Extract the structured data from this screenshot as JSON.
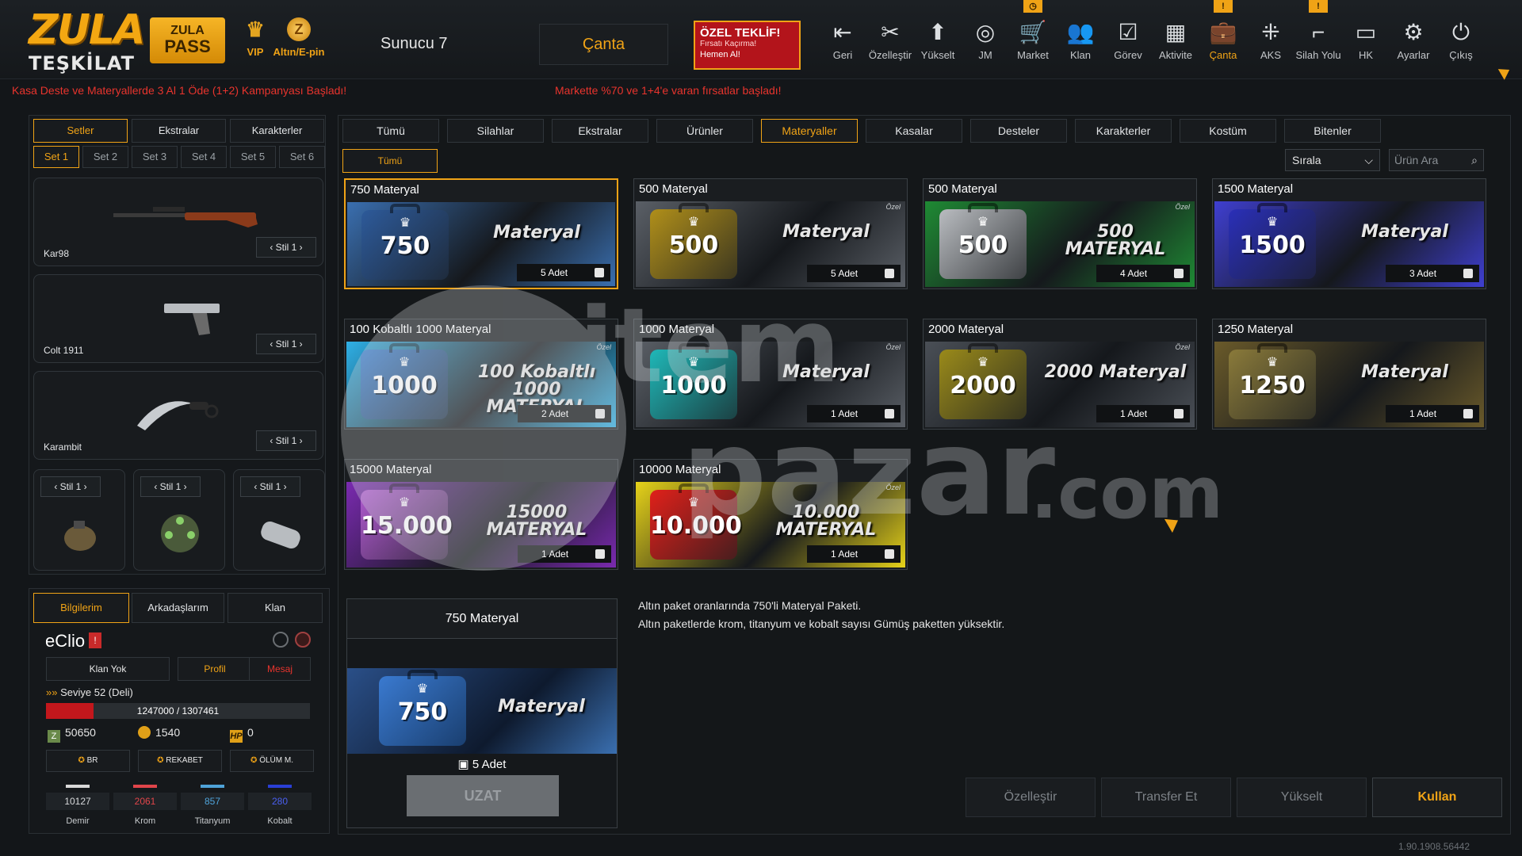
{
  "header": {
    "logo_line1": "ZULA",
    "logo_line2": "TEŞKİLAT",
    "pass_line1": "ZULA",
    "pass_line2": "PASS",
    "vip_label": "VIP",
    "altin_label": "Altın/E-pin",
    "server": "Sunucu 7",
    "canta_label": "Çanta",
    "offer": {
      "title": "ÖZEL TEKLİF!",
      "subtitle": "Fırsatı Kaçırma!",
      "cta": "Hemen Al!"
    },
    "nav": [
      {
        "label": "Geri",
        "icon": "back-icon"
      },
      {
        "label": "Özelleştir",
        "icon": "tools-icon"
      },
      {
        "label": "Yükselt",
        "icon": "upgrade-icon"
      },
      {
        "label": "JM",
        "icon": "coins-icon"
      },
      {
        "label": "Market",
        "icon": "cart-icon"
      },
      {
        "label": "Klan",
        "icon": "clan-icon"
      },
      {
        "label": "Görev",
        "icon": "clipboard-icon"
      },
      {
        "label": "Aktivite",
        "icon": "calendar-check-icon"
      },
      {
        "label": "Çanta",
        "icon": "bag-icon"
      },
      {
        "label": "AKS",
        "icon": "crosshair-icon"
      },
      {
        "label": "Silah Yolu",
        "icon": "gun-icon"
      },
      {
        "label": "HK",
        "icon": "wallet-icon"
      },
      {
        "label": "Ayarlar",
        "icon": "gear-icon"
      },
      {
        "label": "Çıkış",
        "icon": "power-icon"
      }
    ],
    "nav_badges": {
      "market": "◷",
      "canta": "!",
      "silah_yolu": "!"
    }
  },
  "tickers": {
    "left": "Kasa Deste ve Materyallerde 3 Al 1 Öde (1+2) Kampanyası Başladı!",
    "right": "Markette %70 ve 1+4'e varan fırsatlar başladı!"
  },
  "left_panel": {
    "tabs": [
      "Setler",
      "Ekstralar",
      "Karakterler"
    ],
    "set_tabs": [
      "Set 1",
      "Set 2",
      "Set 3",
      "Set 4",
      "Set 5",
      "Set 6"
    ],
    "weapons": [
      {
        "name": "Kar98",
        "style": "Stil 1"
      },
      {
        "name": "Colt 1911",
        "style": "Stil 1"
      },
      {
        "name": "Karambit",
        "style": "Stil 1"
      }
    ],
    "grenades": [
      {
        "style": "Stil 1",
        "icon": "grenade-icon"
      },
      {
        "style": "Stil 1",
        "icon": "mine-icon"
      },
      {
        "style": "Stil 1",
        "icon": "flashbang-icon"
      }
    ]
  },
  "profile": {
    "tabs": [
      "Bilgilerim",
      "Arkadaşlarım",
      "Klan"
    ],
    "name": "eClio",
    "badge": "!",
    "buttons": [
      "Klan Yok",
      "Profil",
      "Mesaj"
    ],
    "level": "Seviye 52 (Deli)",
    "xp_text": "1247000 / 1307461",
    "xp_fraction": 0.18,
    "zp": "50650",
    "gold": "1540",
    "hp": "0",
    "hp_label": "HP",
    "z_label": "Z",
    "mode_buttons": [
      "BR",
      "REKABET",
      "ÖLÜM M."
    ],
    "materials": [
      {
        "value": "10127",
        "label": "Demir",
        "color": "#d9d9d9"
      },
      {
        "value": "2061",
        "label": "Krom",
        "color": "#e0454a"
      },
      {
        "value": "857",
        "label": "Titanyum",
        "color": "#4fa3d9"
      },
      {
        "value": "280",
        "label": "Kobalt",
        "color": "#2a3fd6"
      }
    ]
  },
  "categories": [
    "Tümü",
    "Silahlar",
    "Ekstralar",
    "Ürünler",
    "Materyaller",
    "Kasalar",
    "Desteler",
    "Karakterler",
    "Kostüm",
    "Bitenler"
  ],
  "active_category": "Materyaller",
  "sub_tab": "Tümü",
  "sort_label": "Sırala",
  "search_placeholder": "Ürün Ara",
  "items": [
    {
      "title": "750 Materyal",
      "num": "750",
      "caption": "Materyal",
      "adet": "5 Adet",
      "color": "#2d5a9a",
      "bg": "#3a6fb0",
      "ozel": ""
    },
    {
      "title": "500 Materyal",
      "num": "500",
      "caption": "Materyal",
      "adet": "5 Adet",
      "color": "#b08f1a",
      "bg": "#5a5f66",
      "ozel": "Özel"
    },
    {
      "title": "500 Materyal",
      "num": "500",
      "caption": "500 MATERYAL",
      "adet": "4 Adet",
      "color": "#b9bcc0",
      "bg": "#1f8a34",
      "ozel": "Özel"
    },
    {
      "title": "1500 Materyal",
      "num": "1500",
      "caption": "Materyal",
      "adet": "3 Adet",
      "color": "#2a2fb8",
      "bg": "#3f3fd0",
      "ozel": ""
    },
    {
      "title": "100 Kobaltlı 1000 Materyal",
      "num": "1000",
      "caption": "100 Kobaltlı 1000 MATERYAL",
      "adet": "2 Adet",
      "color": "#3a7fd0",
      "bg": "#2fb0e6",
      "ozel": "Özel"
    },
    {
      "title": "1000 Materyal",
      "num": "1000",
      "caption": "Materyal",
      "adet": "1 Adet",
      "color": "#1fb8b8",
      "bg": "#5a5f66",
      "ozel": "Özel"
    },
    {
      "title": "2000 Materyal",
      "num": "2000",
      "caption": "2000 Materyal",
      "adet": "1 Adet",
      "color": "#9a8a1a",
      "bg": "#4a4f56",
      "ozel": "Özel"
    },
    {
      "title": "1250 Materyal",
      "num": "1250",
      "caption": "Materyal",
      "adet": "1 Adet",
      "color": "#8a7a3a",
      "bg": "#6a5a2a",
      "ozel": ""
    },
    {
      "title": "15000 Materyal",
      "num": "15.000",
      "caption": "15000 MATERYAL",
      "adet": "1 Adet",
      "color": "#b05ad0",
      "bg": "#7a2ab0",
      "ozel": ""
    },
    {
      "title": "10000 Materyal",
      "num": "10.000",
      "caption": "10.000 MATERYAL",
      "adet": "1 Adet",
      "color": "#e0201a",
      "bg": "#e6d21a",
      "ozel": "Özel"
    }
  ],
  "detail": {
    "title": "750 Materyal",
    "num": "750",
    "caption": "Materyal",
    "adet": "5 Adet",
    "uzat": "UZAT",
    "description_1": "Altın paket oranlarında 750'li Materyal Paketi.",
    "description_2": "Altın paketlerde krom, titanyum ve kobalt sayısı Gümüş paketten yüksektir."
  },
  "actions": [
    "Özelleştir",
    "Transfer Et",
    "Yükselt",
    "Kullan"
  ],
  "version": "1.90.1908.56442",
  "watermark": {
    "line1": "item",
    "line2": "pazar",
    "line3": ".com"
  }
}
